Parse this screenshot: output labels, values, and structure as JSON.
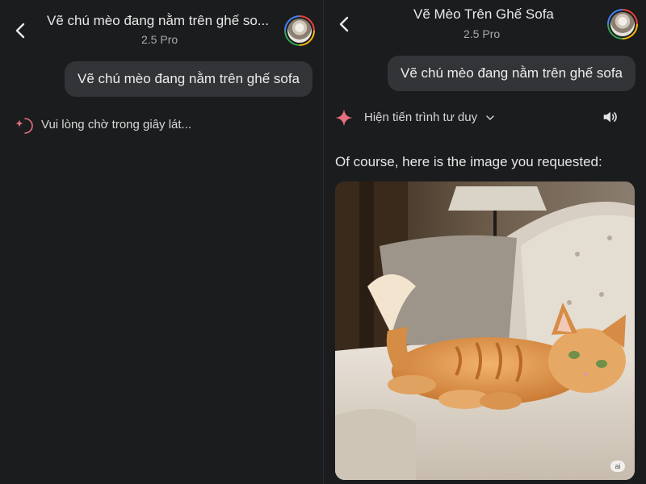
{
  "left": {
    "header": {
      "title": "Vẽ chú mèo đang nằm trên ghế so...",
      "subtitle": "2.5 Pro"
    },
    "user_message": "Vẽ chú mèo đang nằm trên ghế sofa",
    "loading_text": "Vui lòng chờ trong giây lát..."
  },
  "right": {
    "header": {
      "title": "Vẽ Mèo Trên Ghế Sofa",
      "subtitle": "2.5 Pro"
    },
    "user_message": "Vẽ chú mèo đang nằm trên ghế sofa",
    "thinking_label": "Hiện tiến trình tư duy",
    "response_text": "Of course, here is the image you requested:",
    "image_badge": "ai"
  },
  "icons": {
    "back": "chevron-left-icon",
    "sparkle": "gemini-sparkle-icon",
    "speaker": "speaker-icon",
    "dropdown": "chevron-down-icon"
  },
  "colors": {
    "background": "#1b1c1e",
    "bubble": "#333438",
    "sparkle": "#e56f7f"
  }
}
